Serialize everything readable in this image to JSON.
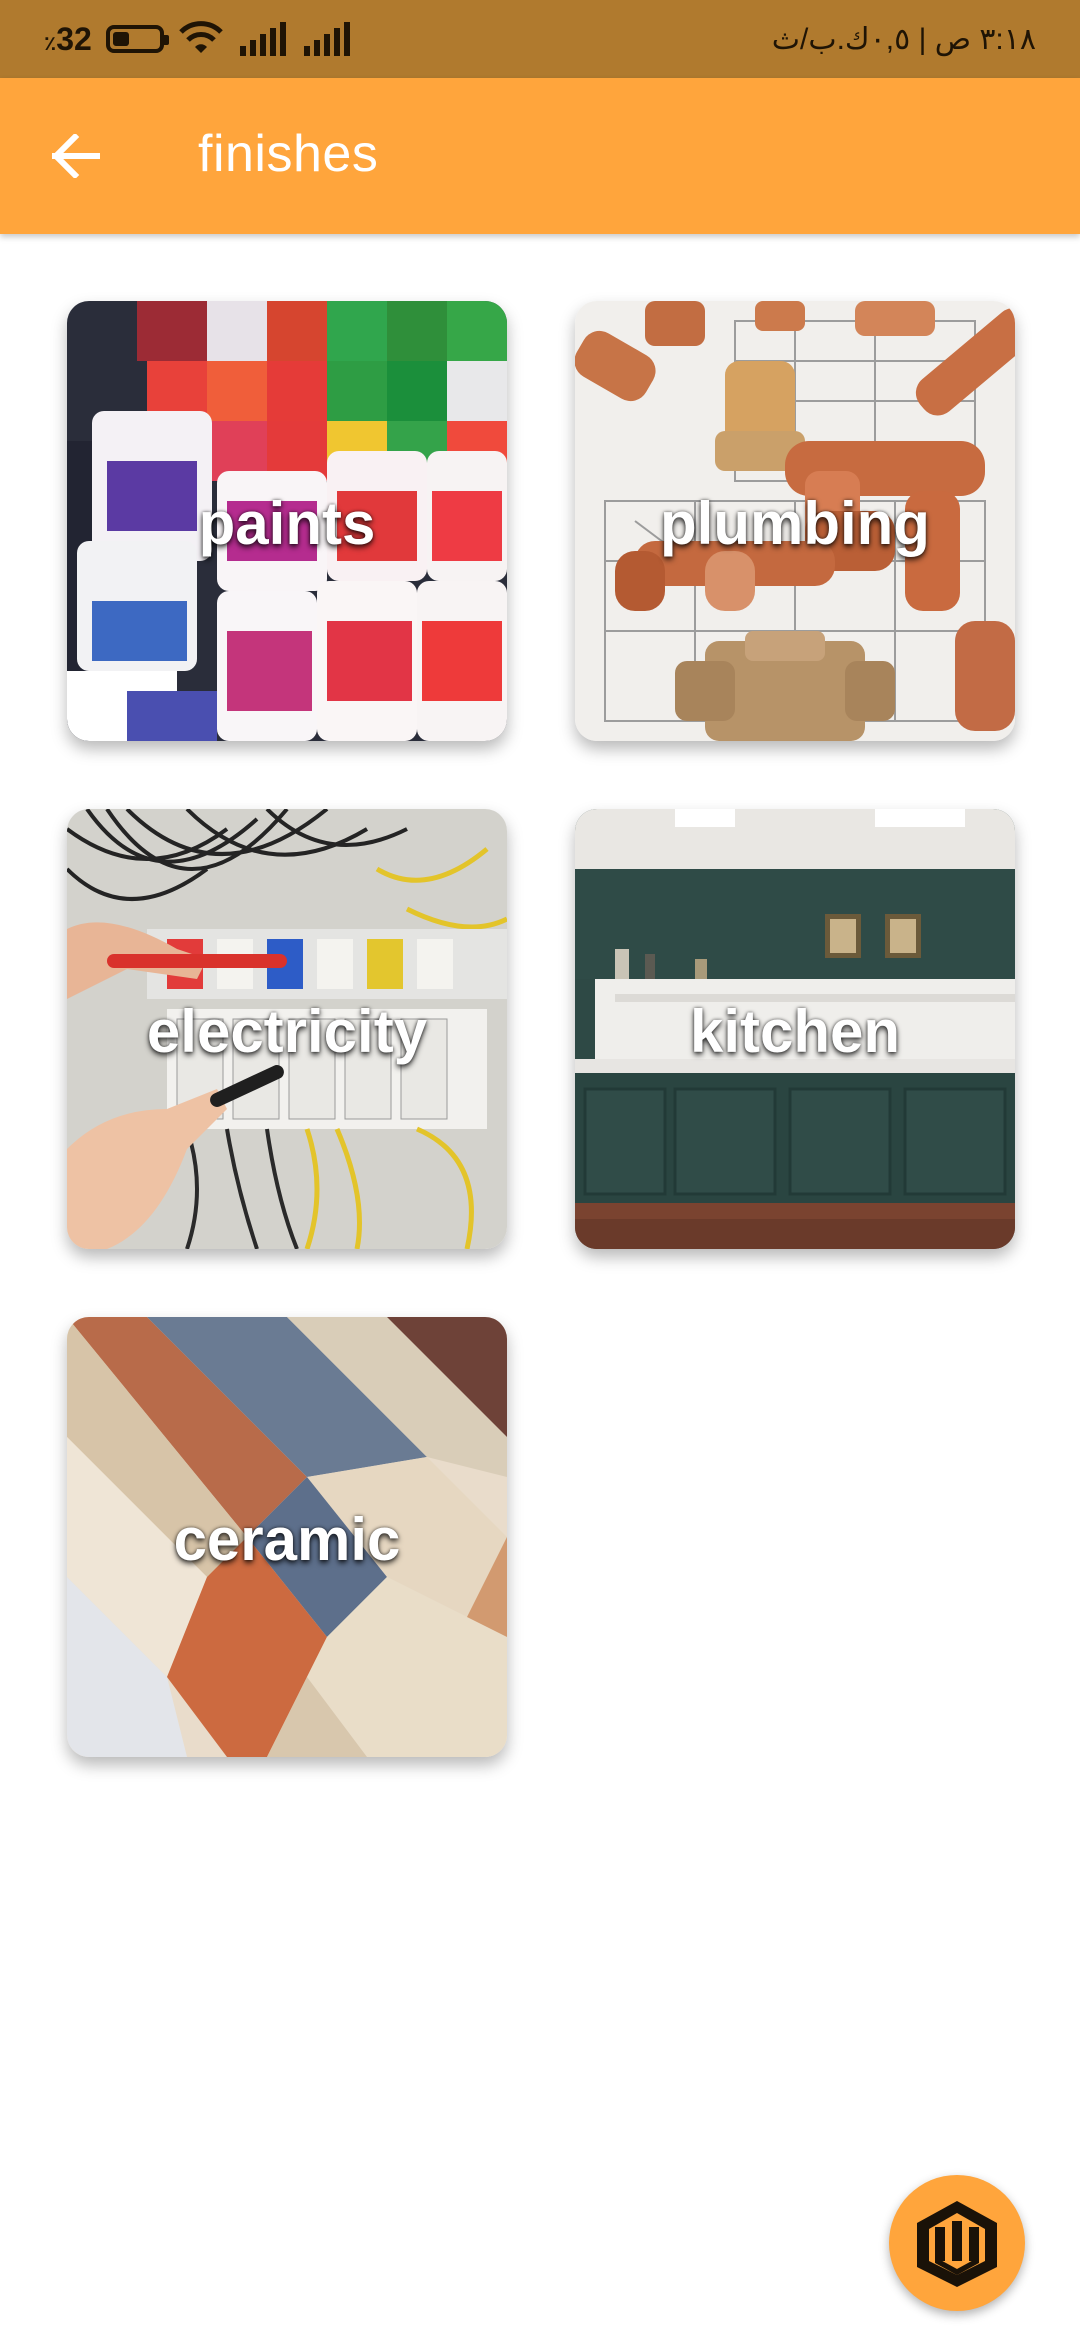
{
  "status_bar": {
    "battery_level": "32",
    "battery_percent_symbol": "٪",
    "right_text": "٣:١٨ ص | ٠,٥ك.ب/ث"
  },
  "app_bar": {
    "title": "finishes"
  },
  "categories": [
    {
      "label": "paints"
    },
    {
      "label": "plumbing"
    },
    {
      "label": "electricity"
    },
    {
      "label": "kitchen"
    },
    {
      "label": "ceramic"
    }
  ],
  "colors": {
    "accent": "#ffa53c",
    "status_bar": "#b07a2e",
    "background": "#ffffff"
  },
  "icons": {
    "back": "arrow-left-icon",
    "fab": "logo-icon",
    "battery": "battery-icon",
    "wifi": "wifi-icon",
    "signal": "signal-icon"
  }
}
